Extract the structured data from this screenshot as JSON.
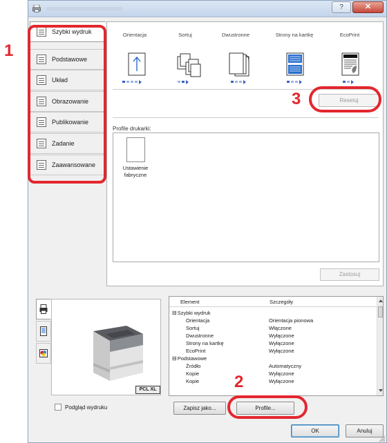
{
  "window": {
    "help_label": "?",
    "close_label": "✕"
  },
  "tabs": [
    {
      "label": "Szybki wydruk",
      "active": true
    },
    {
      "label": "Podstawowe"
    },
    {
      "label": "Układ"
    },
    {
      "label": "Obrazowanie"
    },
    {
      "label": "Publikowanie"
    },
    {
      "label": "Zadanie"
    },
    {
      "label": "Zaawansowane"
    }
  ],
  "quick_print": {
    "items": [
      "Orientacja",
      "Sortuj",
      "Dwustronne",
      "Strony na kartkę",
      "EcoPrint"
    ],
    "reset_label": "Resetuj",
    "profiles_label": "Profile drukarki:",
    "profiles": [
      {
        "label": "Ustawienie fabryczne"
      }
    ],
    "apply_label": "Zastosuj"
  },
  "preview": {
    "pdl_badge": "PCL XL",
    "print_preview_label": "Podgląd wydruku"
  },
  "details": {
    "headers": [
      "Element",
      "Szczegóły"
    ],
    "rows": [
      {
        "name": "Szybki wydruk",
        "value": "",
        "group": true
      },
      {
        "name": "Orientacja",
        "value": "Orientacja pionowa"
      },
      {
        "name": "Sortuj",
        "value": "Włączone"
      },
      {
        "name": "Dwustronne",
        "value": "Wyłączone"
      },
      {
        "name": "Strony na kartkę",
        "value": "Wyłączone"
      },
      {
        "name": "EcoPrint",
        "value": "Wyłączone"
      },
      {
        "name": "Podstawowe",
        "value": "",
        "group": true
      },
      {
        "name": "Źródło",
        "value": "Automatyczny"
      },
      {
        "name": "Kopie",
        "value": "Wyłączone"
      },
      {
        "name": "Kopie",
        "value": "Wyłączone"
      }
    ]
  },
  "footer": {
    "save_as_label": "Zapisz jako...",
    "profiles_button_label": "Profile...",
    "ok_label": "OK",
    "cancel_label": "Anuluj"
  },
  "callouts": [
    "1",
    "2",
    "3"
  ],
  "colors": {
    "highlight": "#e3262e",
    "dots_active": "#3b5fc0"
  }
}
